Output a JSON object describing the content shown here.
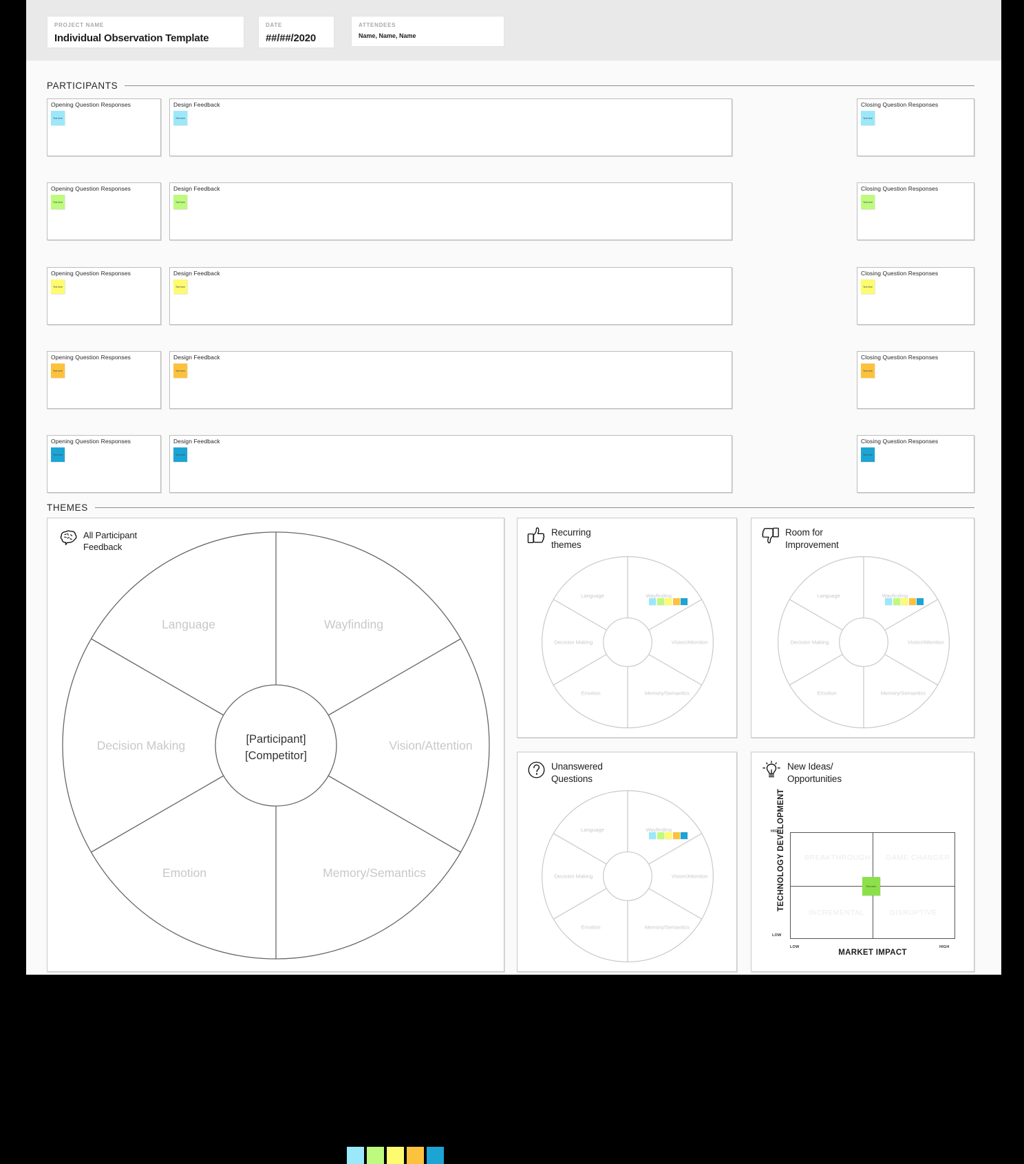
{
  "header": {
    "project": {
      "label": "PROJECT NAME",
      "value": "Individual Observation Template"
    },
    "date": {
      "label": "DATE",
      "value": "##/##/2020"
    },
    "attendees": {
      "label": "ATTENDEES",
      "value": "Name, Name, Name"
    }
  },
  "sections": {
    "participants": "PARTICIPANTS",
    "themes": "THEMES"
  },
  "participant_columns": {
    "opening": "Opening Question Responses",
    "feedback": "Design Feedback",
    "closing": "Closing Question Responses"
  },
  "note_text": "Text here",
  "participant_rows": [
    {
      "color": "#9BE8FB"
    },
    {
      "color": "#BDFA7E"
    },
    {
      "color": "#FDFB70"
    },
    {
      "color": "#FCC23E"
    },
    {
      "color": "#1CA4D4"
    }
  ],
  "palette": [
    "#9BE8FB",
    "#BDFA7E",
    "#FDFB70",
    "#FCC23E",
    "#1CA4D4"
  ],
  "wheel": {
    "segments": [
      "Language",
      "Wayfinding",
      "Vision/Attention",
      "Memory/Semantics",
      "Emotion",
      "Decision Making"
    ],
    "center_line1": "[Participant]",
    "center_line2": "[Competitor]",
    "marked_segment": "Wayfinding"
  },
  "panels": {
    "all_feedback": {
      "title": "All Participant\nFeedback",
      "icon": "brain-icon"
    },
    "recurring": {
      "title": "Recurring\nthemes",
      "icon": "thumbs-up-icon"
    },
    "room": {
      "title": "Room for\nImprovement",
      "icon": "thumbs-down-icon"
    },
    "unanswered": {
      "title": "Unanswered\nQuestions",
      "icon": "question-mark-icon"
    },
    "ideas": {
      "title": "New Ideas/\nOpportunities",
      "icon": "lightbulb-icon"
    }
  },
  "chart_data": {
    "type": "scatter",
    "title": "New Ideas/ Opportunities",
    "xlabel": "MARKET IMPACT",
    "ylabel": "TECHNOLOGY DEVELOPMENT",
    "xticks": [
      "LOW",
      "HIGH"
    ],
    "yticks": [
      "LOW",
      "HIGH"
    ],
    "xlim": [
      0,
      1
    ],
    "ylim": [
      0,
      1
    ],
    "grid": false,
    "quadrants": [
      {
        "name": "BREAKTHROUGH",
        "x": "low",
        "y": "high"
      },
      {
        "name": "GAME CHANGER",
        "x": "high",
        "y": "high"
      },
      {
        "name": "INCREMENTAL",
        "x": "low",
        "y": "low"
      },
      {
        "name": "DISRUPTIVE",
        "x": "high",
        "y": "low"
      }
    ],
    "points": [
      {
        "label": "Text here",
        "x": 0.5,
        "y": 0.5,
        "color": "#8CE04A"
      }
    ]
  }
}
